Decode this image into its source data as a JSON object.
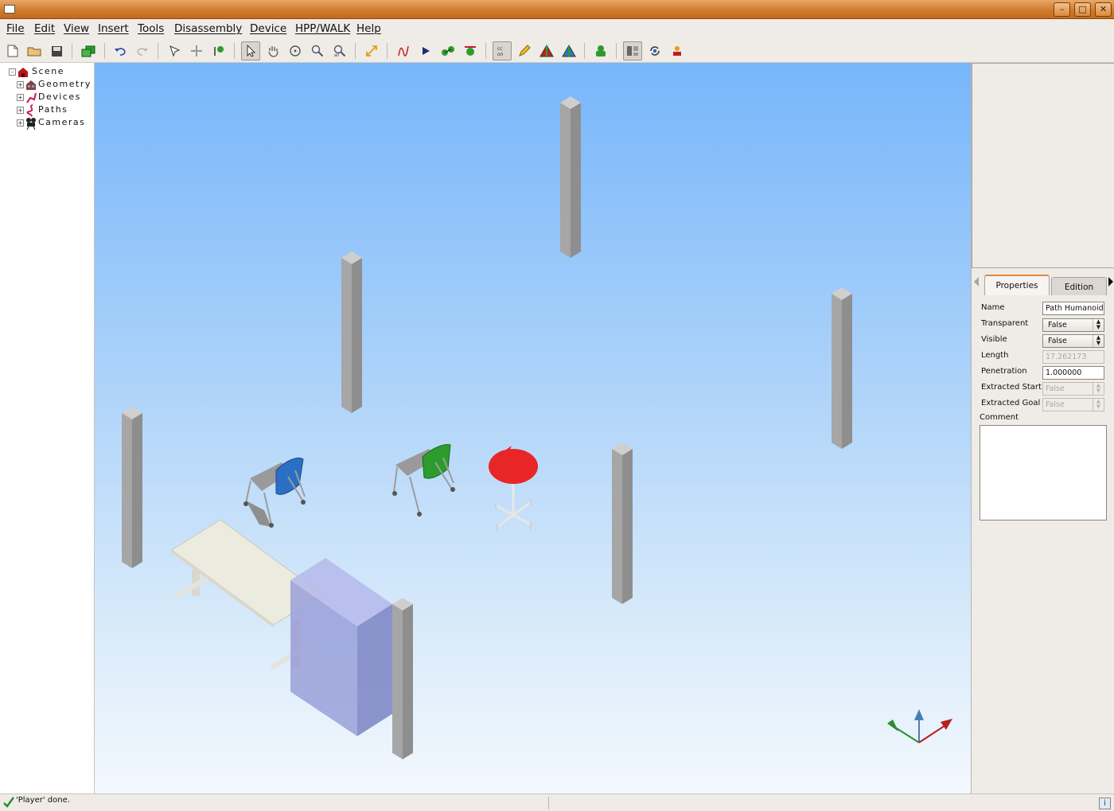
{
  "menu": [
    "File",
    "Edit",
    "View",
    "Insert",
    "Tools",
    "Disassembly",
    "Device",
    "HPP/WALK",
    "Help"
  ],
  "window_buttons": {
    "minimize": "–",
    "maximize": "□",
    "close": "✕"
  },
  "tree": {
    "root": "Scene",
    "children": [
      "Geometry",
      "Devices",
      "Paths",
      "Cameras"
    ]
  },
  "panel": {
    "tabs": {
      "properties": "Properties",
      "edition": "Edition"
    },
    "fields": {
      "name_label": "Name",
      "name_value": "Path Humanoid",
      "transparent_label": "Transparent",
      "transparent_value": "False",
      "visible_label": "Visible",
      "visible_value": "False",
      "length_label": "Length",
      "length_value": "17.262173",
      "penetration_label": "Penetration",
      "penetration_value": "1.000000",
      "extracted_start_label": "Extracted Start",
      "extracted_start_value": "False",
      "extracted_goal_label": "Extracted Goal",
      "extracted_goal_value": "False",
      "comment_label": "Comment"
    }
  },
  "status": {
    "message": "'Player' done.",
    "info": "i"
  },
  "colors": {
    "title_orange": "#d07b2c",
    "sky_top": "#77b6fb",
    "pillar": "#a8a8a8",
    "table_top": "#ecebe0",
    "cabinet": "#9aa2d6",
    "chair_blue": "#2a6fc4",
    "chair_green": "#2c9c2c",
    "stool_red": "#e82626"
  }
}
